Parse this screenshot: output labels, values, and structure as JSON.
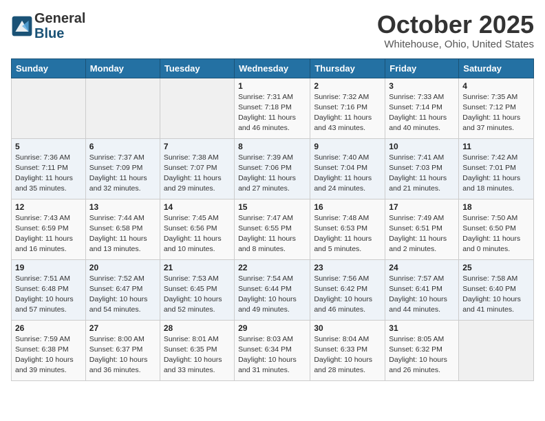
{
  "header": {
    "logo_general": "General",
    "logo_blue": "Blue",
    "month": "October 2025",
    "location": "Whitehouse, Ohio, United States"
  },
  "days_of_week": [
    "Sunday",
    "Monday",
    "Tuesday",
    "Wednesday",
    "Thursday",
    "Friday",
    "Saturday"
  ],
  "weeks": [
    [
      {
        "day": "",
        "info": ""
      },
      {
        "day": "",
        "info": ""
      },
      {
        "day": "",
        "info": ""
      },
      {
        "day": "1",
        "info": "Sunrise: 7:31 AM\nSunset: 7:18 PM\nDaylight: 11 hours and 46 minutes."
      },
      {
        "day": "2",
        "info": "Sunrise: 7:32 AM\nSunset: 7:16 PM\nDaylight: 11 hours and 43 minutes."
      },
      {
        "day": "3",
        "info": "Sunrise: 7:33 AM\nSunset: 7:14 PM\nDaylight: 11 hours and 40 minutes."
      },
      {
        "day": "4",
        "info": "Sunrise: 7:35 AM\nSunset: 7:12 PM\nDaylight: 11 hours and 37 minutes."
      }
    ],
    [
      {
        "day": "5",
        "info": "Sunrise: 7:36 AM\nSunset: 7:11 PM\nDaylight: 11 hours and 35 minutes."
      },
      {
        "day": "6",
        "info": "Sunrise: 7:37 AM\nSunset: 7:09 PM\nDaylight: 11 hours and 32 minutes."
      },
      {
        "day": "7",
        "info": "Sunrise: 7:38 AM\nSunset: 7:07 PM\nDaylight: 11 hours and 29 minutes."
      },
      {
        "day": "8",
        "info": "Sunrise: 7:39 AM\nSunset: 7:06 PM\nDaylight: 11 hours and 27 minutes."
      },
      {
        "day": "9",
        "info": "Sunrise: 7:40 AM\nSunset: 7:04 PM\nDaylight: 11 hours and 24 minutes."
      },
      {
        "day": "10",
        "info": "Sunrise: 7:41 AM\nSunset: 7:03 PM\nDaylight: 11 hours and 21 minutes."
      },
      {
        "day": "11",
        "info": "Sunrise: 7:42 AM\nSunset: 7:01 PM\nDaylight: 11 hours and 18 minutes."
      }
    ],
    [
      {
        "day": "12",
        "info": "Sunrise: 7:43 AM\nSunset: 6:59 PM\nDaylight: 11 hours and 16 minutes."
      },
      {
        "day": "13",
        "info": "Sunrise: 7:44 AM\nSunset: 6:58 PM\nDaylight: 11 hours and 13 minutes."
      },
      {
        "day": "14",
        "info": "Sunrise: 7:45 AM\nSunset: 6:56 PM\nDaylight: 11 hours and 10 minutes."
      },
      {
        "day": "15",
        "info": "Sunrise: 7:47 AM\nSunset: 6:55 PM\nDaylight: 11 hours and 8 minutes."
      },
      {
        "day": "16",
        "info": "Sunrise: 7:48 AM\nSunset: 6:53 PM\nDaylight: 11 hours and 5 minutes."
      },
      {
        "day": "17",
        "info": "Sunrise: 7:49 AM\nSunset: 6:51 PM\nDaylight: 11 hours and 2 minutes."
      },
      {
        "day": "18",
        "info": "Sunrise: 7:50 AM\nSunset: 6:50 PM\nDaylight: 11 hours and 0 minutes."
      }
    ],
    [
      {
        "day": "19",
        "info": "Sunrise: 7:51 AM\nSunset: 6:48 PM\nDaylight: 10 hours and 57 minutes."
      },
      {
        "day": "20",
        "info": "Sunrise: 7:52 AM\nSunset: 6:47 PM\nDaylight: 10 hours and 54 minutes."
      },
      {
        "day": "21",
        "info": "Sunrise: 7:53 AM\nSunset: 6:45 PM\nDaylight: 10 hours and 52 minutes."
      },
      {
        "day": "22",
        "info": "Sunrise: 7:54 AM\nSunset: 6:44 PM\nDaylight: 10 hours and 49 minutes."
      },
      {
        "day": "23",
        "info": "Sunrise: 7:56 AM\nSunset: 6:42 PM\nDaylight: 10 hours and 46 minutes."
      },
      {
        "day": "24",
        "info": "Sunrise: 7:57 AM\nSunset: 6:41 PM\nDaylight: 10 hours and 44 minutes."
      },
      {
        "day": "25",
        "info": "Sunrise: 7:58 AM\nSunset: 6:40 PM\nDaylight: 10 hours and 41 minutes."
      }
    ],
    [
      {
        "day": "26",
        "info": "Sunrise: 7:59 AM\nSunset: 6:38 PM\nDaylight: 10 hours and 39 minutes."
      },
      {
        "day": "27",
        "info": "Sunrise: 8:00 AM\nSunset: 6:37 PM\nDaylight: 10 hours and 36 minutes."
      },
      {
        "day": "28",
        "info": "Sunrise: 8:01 AM\nSunset: 6:35 PM\nDaylight: 10 hours and 33 minutes."
      },
      {
        "day": "29",
        "info": "Sunrise: 8:03 AM\nSunset: 6:34 PM\nDaylight: 10 hours and 31 minutes."
      },
      {
        "day": "30",
        "info": "Sunrise: 8:04 AM\nSunset: 6:33 PM\nDaylight: 10 hours and 28 minutes."
      },
      {
        "day": "31",
        "info": "Sunrise: 8:05 AM\nSunset: 6:32 PM\nDaylight: 10 hours and 26 minutes."
      },
      {
        "day": "",
        "info": ""
      }
    ]
  ]
}
